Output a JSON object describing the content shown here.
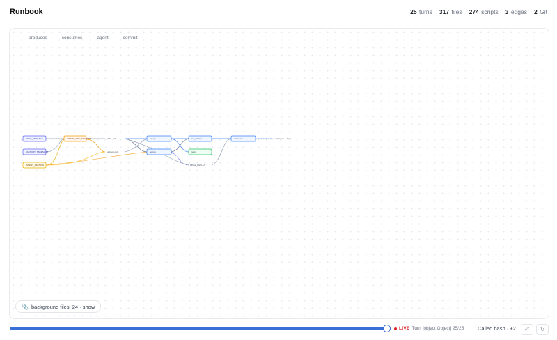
{
  "app": {
    "title": "Runbook"
  },
  "stats": [
    {
      "value": "25",
      "label": "turns"
    },
    {
      "value": "317",
      "label": "files"
    },
    {
      "value": "274",
      "label": "scripts"
    },
    {
      "value": "3",
      "label": "edges"
    },
    {
      "value": "2",
      "label": "Git"
    }
  ],
  "legend": [
    {
      "label": "produces",
      "color": "#3b82f6"
    },
    {
      "label": "consumes",
      "color": "#64748b"
    },
    {
      "label": "agent",
      "color": "#6366f1"
    },
    {
      "label": "commit",
      "color": "#eab308"
    }
  ],
  "graph_nodes": [
    {
      "label": "USER_MESSAGE"
    },
    {
      "label": "FACTORY_SNAPSHOT"
    },
    {
      "label": "INSERT_SECTION"
    },
    {
      "label": "INSERT_DOC_SECTION"
    },
    {
      "label": "SKILL.md"
    },
    {
      "label": "runbook.md"
    },
    {
      "label": "run.py"
    },
    {
      "label": "test.py"
    },
    {
      "label": "run_history"
    },
    {
      "label": "reply"
    },
    {
      "label": "FINAL_RESULT"
    },
    {
      "label": "notes.md"
    },
    {
      "label": "deploy.sh"
    },
    {
      "label": "final"
    }
  ],
  "background_files": {
    "label": "background files: 24 · show",
    "icon": "paperclip-icon"
  },
  "timeline": {
    "progress": 1.0
  },
  "status": {
    "live": "LIVE",
    "turn_text": "Turn [object Object] 25/25",
    "called": "Called bash · +2"
  },
  "controls": {
    "expand_icon": "expand-icon",
    "expand_glyph": "⤢",
    "reset_icon": "reset-icon",
    "reset_glyph": "↻"
  }
}
